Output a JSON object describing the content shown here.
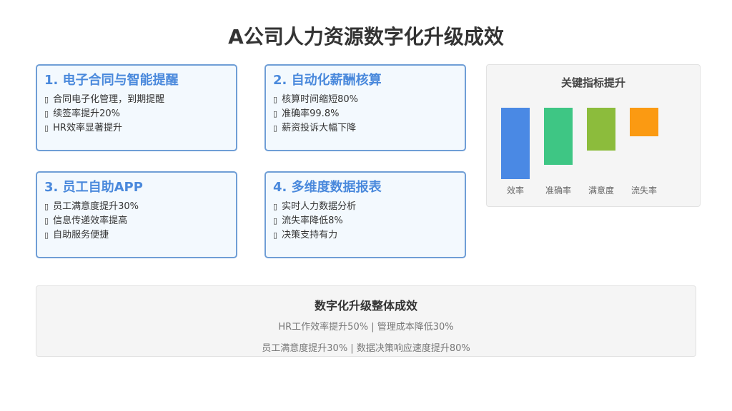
{
  "title": "A公司人力资源数字化升级成效",
  "bullet_icon": "square-bullet-icon",
  "cards": [
    {
      "title": "1. 电子合同与智能提醒",
      "items": [
        "合同电子化管理，到期提醒",
        "续签率提升20%",
        "HR效率显著提升"
      ]
    },
    {
      "title": "2. 自动化薪酬核算",
      "items": [
        "核算时间缩短80%",
        "准确率99.8%",
        "薪资投诉大幅下降"
      ]
    },
    {
      "title": "3. 员工自助APP",
      "items": [
        "员工满意度提升30%",
        "信息传递效率提高",
        "自助服务便捷"
      ]
    },
    {
      "title": "4. 多维度数据报表",
      "items": [
        "实时人力数据分析",
        "流失率降低8%",
        "决策支持有力"
      ]
    }
  ],
  "chart_data": {
    "type": "bar",
    "title": "关键指标提升",
    "categories": [
      "效率",
      "准确率",
      "满意度",
      "流失率"
    ],
    "values": [
      50,
      40,
      30,
      20
    ],
    "colors": [
      "#4a89e4",
      "#3ec684",
      "#8cbc3c",
      "#fb9a12"
    ],
    "xlabel": "",
    "ylabel": "",
    "grid": false
  },
  "summary": {
    "title": "数字化升级整体成效",
    "line1": "HR工作效率提升50% | 管理成本降低30%",
    "line2": "员工满意度提升30% | 数据决策响应速度提升80%"
  }
}
